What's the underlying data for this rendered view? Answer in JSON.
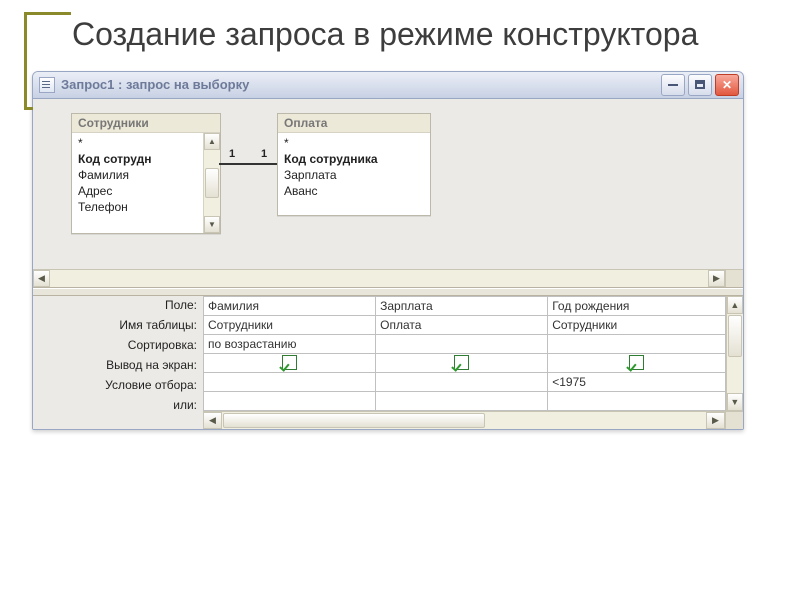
{
  "slide": {
    "title": "Создание запроса в режиме конструктора"
  },
  "window": {
    "title": "Запрос1 : запрос на выборку"
  },
  "tables": {
    "t1": {
      "name": "Сотрудники",
      "fields": [
        "*",
        "Код сотрудн",
        "Фамилия",
        "Адрес",
        "Телефон"
      ],
      "bold_index": 1
    },
    "t2": {
      "name": "Оплата",
      "fields": [
        "*",
        "Код сотрудника",
        "Зарплата",
        "Аванс"
      ],
      "bold_index": 1
    },
    "relation": {
      "left_card": "1",
      "right_card": "1"
    }
  },
  "grid": {
    "row_labels": {
      "field": "Поле:",
      "table": "Имя таблицы:",
      "sort": "Сортировка:",
      "show": "Вывод на экран:",
      "criteria": "Условие отбора:",
      "or": "или:"
    },
    "columns": [
      {
        "field": "Фамилия",
        "table": "Сотрудники",
        "sort": "по возрастанию",
        "show": true,
        "criteria": "",
        "or": ""
      },
      {
        "field": "Зарплата",
        "table": "Оплата",
        "sort": "",
        "show": true,
        "criteria": "",
        "or": ""
      },
      {
        "field": "Год рождения",
        "table": "Сотрудники",
        "sort": "",
        "show": true,
        "criteria": "<1975",
        "or": ""
      }
    ]
  }
}
